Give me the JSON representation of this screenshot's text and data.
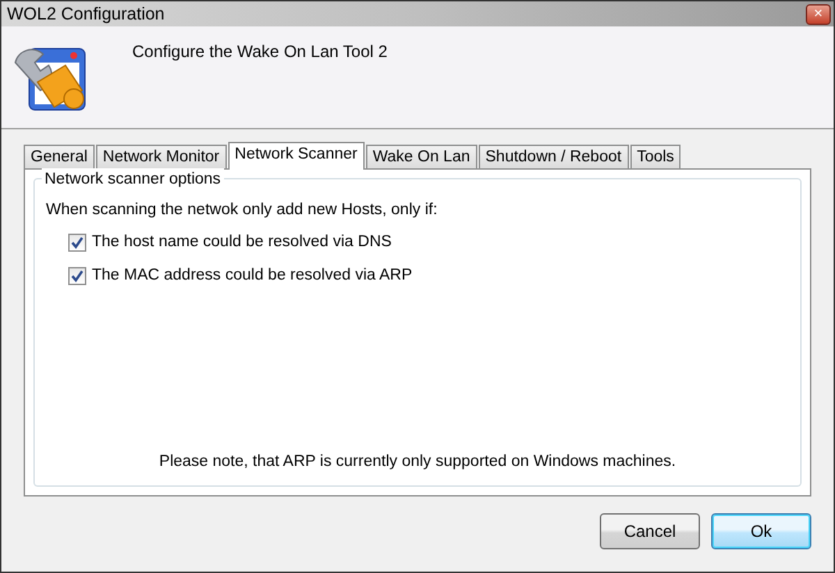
{
  "window": {
    "title": "WOL2 Configuration",
    "close": "×"
  },
  "header": {
    "text": "Configure the Wake On Lan Tool 2"
  },
  "tabs": [
    {
      "label": "General",
      "selected": false
    },
    {
      "label": "Network Monitor",
      "selected": false
    },
    {
      "label": "Network Scanner",
      "selected": true
    },
    {
      "label": "Wake On Lan",
      "selected": false
    },
    {
      "label": "Shutdown / Reboot",
      "selected": false
    },
    {
      "label": "Tools",
      "selected": false
    }
  ],
  "group": {
    "title": "Network scanner options",
    "intro": "When scanning the netwok only add new Hosts, only if:",
    "options": [
      {
        "label": "The host name could be resolved via DNS",
        "checked": true
      },
      {
        "label": "The MAC address could be resolved via ARP",
        "checked": true
      }
    ],
    "note": "Please note, that ARP is currently only supported on Windows machines."
  },
  "buttons": [
    {
      "label": "Cancel",
      "default": false
    },
    {
      "label": "Ok",
      "default": true
    }
  ]
}
